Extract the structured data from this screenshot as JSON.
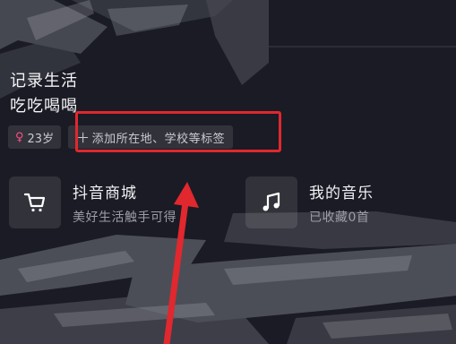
{
  "profile": {
    "bio_line1": "记录生活",
    "bio_line2": "吃吃喝喝",
    "age_tag": "23岁",
    "add_tag_label": "添加所在地、学校等标签"
  },
  "cards": {
    "shop": {
      "title": "抖音商城",
      "subtitle": "美好生活触手可得"
    },
    "music": {
      "title": "我的音乐",
      "subtitle": "已收藏0首"
    }
  },
  "icons": {
    "age": "female-symbol-icon",
    "add": "plus-icon",
    "shop": "shopping-cart-icon",
    "music": "music-note-icon"
  },
  "colors": {
    "background": "#1a1b24",
    "annotation_red": "#e0282e",
    "female_pink": "#ff4f86"
  }
}
